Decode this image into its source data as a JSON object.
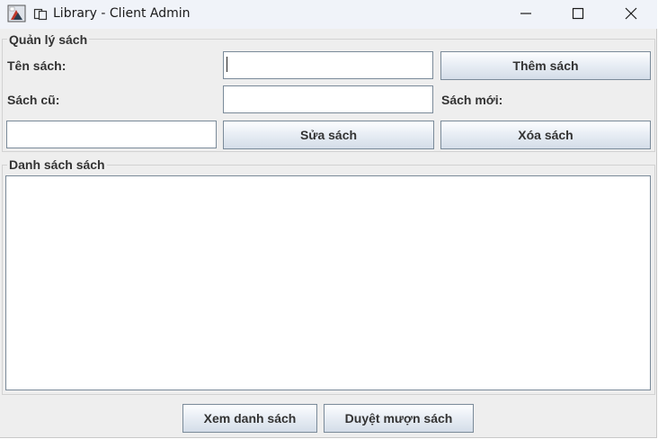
{
  "window": {
    "title": "Library - Client Admin",
    "icons": [
      "app-icon",
      "copy-icon",
      "minimize-icon",
      "maximize-icon",
      "close-icon"
    ]
  },
  "manage_panel": {
    "title": "Quản lý sách",
    "book_name_label": "Tên sách:",
    "book_name_value": "",
    "add_button": "Thêm sách",
    "old_book_label": "Sách cũ:",
    "old_book_value": "",
    "new_book_label": "Sách mới:",
    "new_book_value": "",
    "edit_button": "Sửa sách",
    "delete_button": "Xóa sách"
  },
  "list_panel": {
    "title": "Danh sách sách",
    "items": []
  },
  "footer": {
    "view_list_button": "Xem danh sách",
    "approve_borrow_button": "Duyệt mượn sách"
  }
}
